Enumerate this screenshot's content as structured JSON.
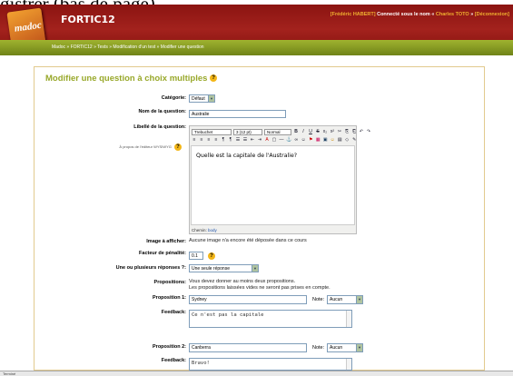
{
  "caption": "gistrer (bas de page)",
  "app": {
    "title": "FORTIC12",
    "logo_text": "madoc"
  },
  "user_bar": {
    "user": "[Frédéric HABERT]",
    "connected_as": "Connecté sous le nom «",
    "as_name": "Charles TOTO",
    "close_quote": "»",
    "logout": "[Déconnexion]"
  },
  "breadcrumb": {
    "items": [
      "Madoc",
      "FORTIC12",
      "Tests",
      "Modification d'un test"
    ],
    "separator": "»",
    "current": "Modifier une question"
  },
  "form": {
    "title": "Modifier une question à choix multiples",
    "help_icon": "?",
    "category_label": "Catégorie:",
    "category_value": "Défaut",
    "name_label": "Nom de la question:",
    "name_value": "Australie",
    "wording_label": "Libellé de la question:",
    "about_editor": "À propos de l'éditeur WYSIWYG",
    "editor": {
      "font": "Trebuchet",
      "size": "3 (12 pt)",
      "style": "Normal",
      "content": "Quelle est la capitale de l'Australie?",
      "path_label": "Chemin:",
      "path_value": "body",
      "toolbar_row1": [
        "B",
        "I",
        "U",
        "S",
        "x₂",
        "x²",
        "✂",
        "⎘",
        "⎗",
        "↶",
        "↷"
      ],
      "toolbar_row2": [
        "≡",
        "≡",
        "≡",
        "≡",
        "¶",
        "¶",
        "☰",
        "☰",
        "⇤",
        "⇥",
        "A",
        "▢",
        "—",
        "⚓",
        "∞",
        "☺",
        "⚑",
        "▦",
        "▣",
        "☺",
        "▤",
        "◇",
        "✎"
      ]
    },
    "image_label": "Image à afficher:",
    "image_value": "Aucune image n'a encore été déposée dans ce cours",
    "penalty_label": "Facteur de pénalité:",
    "penalty_value": "0.1",
    "answers_label": "Une ou plusieurs réponses ?:",
    "answers_value": "Une seule réponse",
    "propositions_label": "Propositions:",
    "propositions_note1": "Vous devez donner au moins deux propositions.",
    "propositions_note2": "Les propositions laissées vides ne seront pas prises en compte.",
    "p1_label": "Proposition 1:",
    "p1_value": "Sydney",
    "note_label": "Note:",
    "p1_note": "Aucun",
    "feedback_label": "Feedback:",
    "f1_value": "Ce n'est pas la capitale",
    "p2_label": "Proposition 2:",
    "p2_value": "Canberra",
    "p2_note": "Aucun",
    "f2_value": "Bravo!"
  },
  "status": {
    "left": "Terminé"
  }
}
